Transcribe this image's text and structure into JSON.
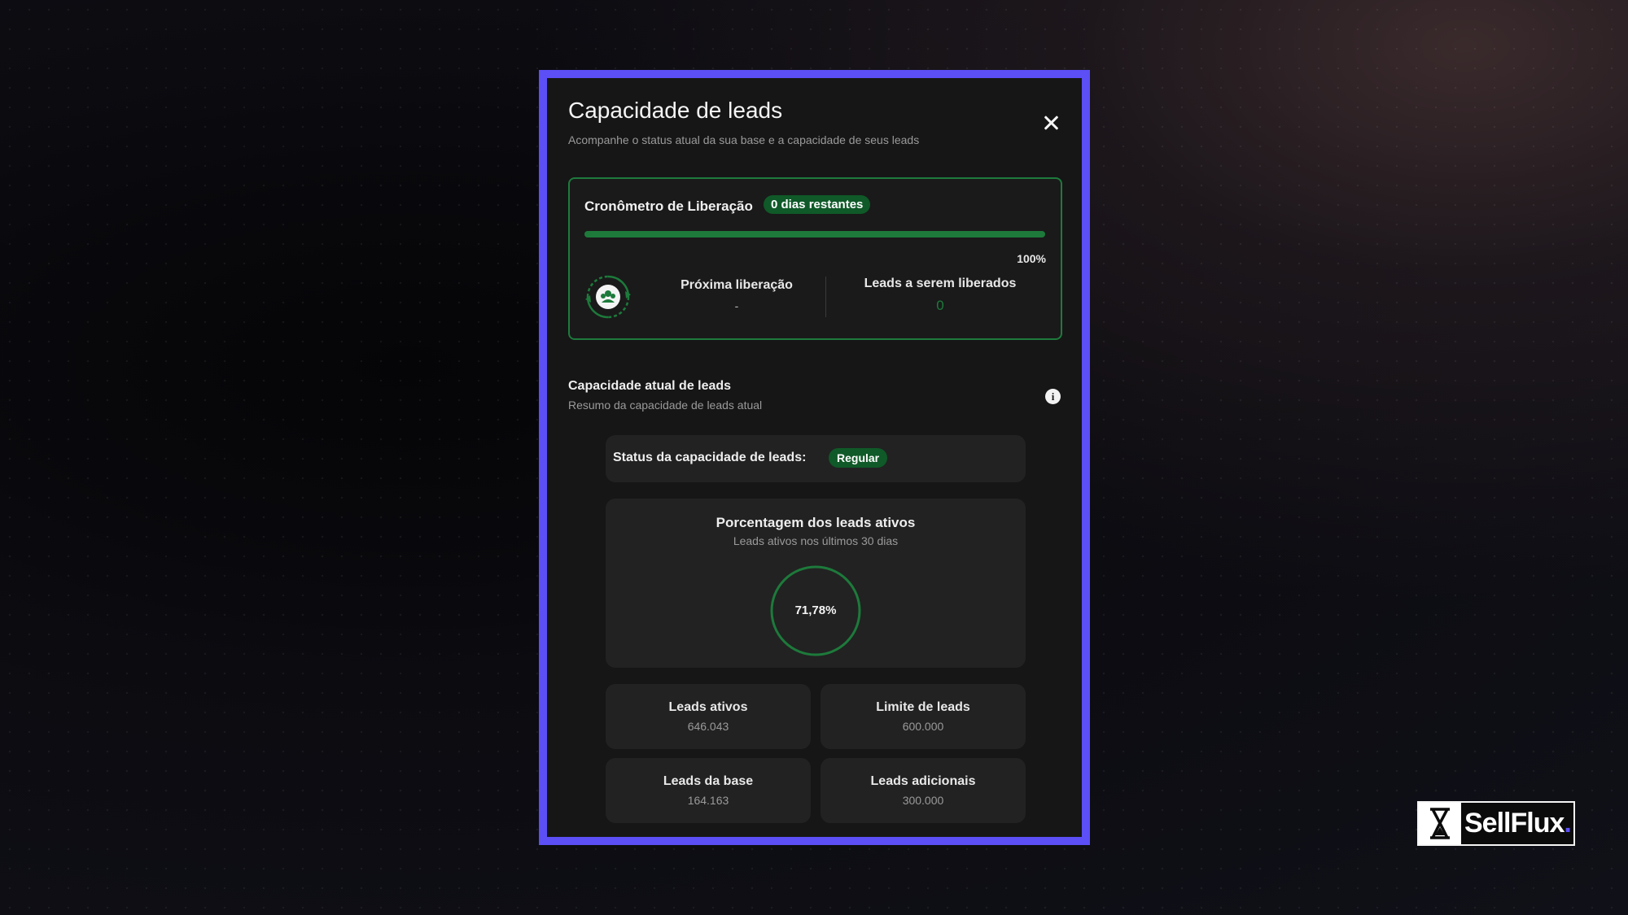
{
  "modal": {
    "title": "Capacidade de leads",
    "subtitle": "Acompanhe o status atual da sua base e a capacidade de seus leads"
  },
  "timer": {
    "title": "Cronômetro de Liberação",
    "days_badge": "0 dias restantes",
    "progress_percent": 100,
    "progress_label": "100%",
    "next_release_label": "Próxima liberação",
    "next_release_value": "-",
    "leads_to_release_label": "Leads a serem liberados",
    "leads_to_release_value": "0"
  },
  "capacity": {
    "title": "Capacidade atual de leads",
    "subtitle": "Resumo da capacidade de leads atual",
    "status_label": "Status da capacidade de leads:",
    "status_value": "Regular",
    "percent_title": "Porcentagem dos leads ativos",
    "percent_subtitle": "Leads ativos nos últimos 30 dias",
    "percent_value": "71,78%",
    "stats": [
      {
        "label": "Leads ativos",
        "value": "646.043"
      },
      {
        "label": "Limite de leads",
        "value": "600.000"
      },
      {
        "label": "Leads da base",
        "value": "164.163"
      },
      {
        "label": "Leads adicionais",
        "value": "300.000"
      }
    ]
  },
  "logo": {
    "text": "SellFlux",
    "dot": "."
  },
  "colors": {
    "accent_border": "#5b4ff5",
    "success_green": "#1d7a3b",
    "badge_green": "#0f5a28",
    "card_bg": "#222222",
    "modal_bg": "#161616"
  },
  "icons": {
    "close": "close-icon",
    "release": "release-cycle-icon",
    "info": "info-icon",
    "logo": "hourglass-logo-icon"
  }
}
